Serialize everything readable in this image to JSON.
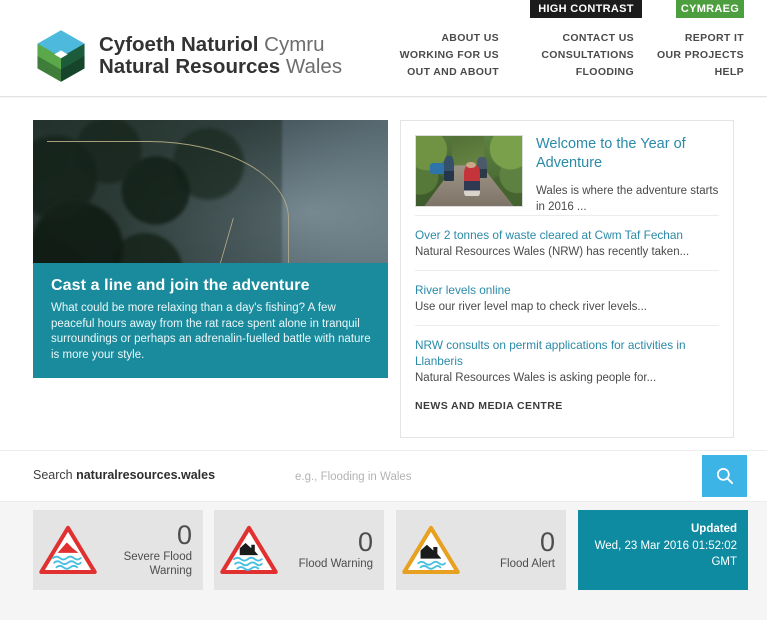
{
  "header": {
    "high_contrast": "HIGH CONTRAST",
    "cymraeg": "CYMRAEG",
    "logo_line1_bold": "Cyfoeth Naturiol",
    "logo_line1_light": "Cymru",
    "logo_line2_bold": "Natural Resources",
    "logo_line2_light": "Wales",
    "nav_col1": [
      "ABOUT US",
      "WORKING FOR US",
      "OUT AND ABOUT"
    ],
    "nav_col2": [
      "CONTACT US",
      "CONSULTATIONS",
      "FLOODING"
    ],
    "nav_col3": [
      "REPORT IT",
      "OUR PROJECTS",
      "HELP"
    ]
  },
  "hero": {
    "title": "Cast a line and join the adventure",
    "body": "What could be more relaxing than a day's fishing? A few peaceful hours away from the rat race spent alone in tranquil surroundings or perhaps an adrenalin-fuelled battle with nature is more your style.",
    "image_alt": "fly-fisherman-casting"
  },
  "news": {
    "feature": {
      "title": "Welcome to the Year of Adventure",
      "desc": "Wales is where the adventure starts in 2016 ...",
      "thumb_alt": "child-running-on-forest-path"
    },
    "items": [
      {
        "link": "Over 2 tonnes of waste cleared at Cwm Taf Fechan",
        "sub": "Natural Resources Wales (NRW) has recently taken..."
      },
      {
        "link": "River levels online",
        "sub": "Use our river level map to check river levels..."
      },
      {
        "link": "NRW consults on permit applications for activities in Llanberis",
        "sub": "Natural Resources Wales is asking people for..."
      }
    ],
    "centre_label": "NEWS AND MEDIA CENTRE"
  },
  "search": {
    "label_prefix": "Search ",
    "label_domain": "naturalresources.wales",
    "placeholder": "e.g., Flooding in Wales",
    "value": "",
    "button_icon": "search-icon"
  },
  "flood": {
    "cards": [
      {
        "count": "0",
        "label": "Severe Flood Warning",
        "icon": "severe-flood-warning-icon"
      },
      {
        "count": "0",
        "label": "Flood Warning",
        "icon": "flood-warning-icon"
      },
      {
        "count": "0",
        "label": "Flood Alert",
        "icon": "flood-alert-icon"
      }
    ],
    "updated_title": "Updated",
    "updated_date": "Wed, 23 Mar 2016 01:52:02 GMT"
  },
  "colors": {
    "teal": "#1a8b9c",
    "teal_dark": "#0e8ba0",
    "link_blue": "#2a8aa8",
    "search_blue": "#3cb4e5",
    "green_btn": "#4c9e3f",
    "black_btn": "#1c1c1c",
    "severe_red": "#e03030",
    "alert_orange": "#e8a020"
  }
}
